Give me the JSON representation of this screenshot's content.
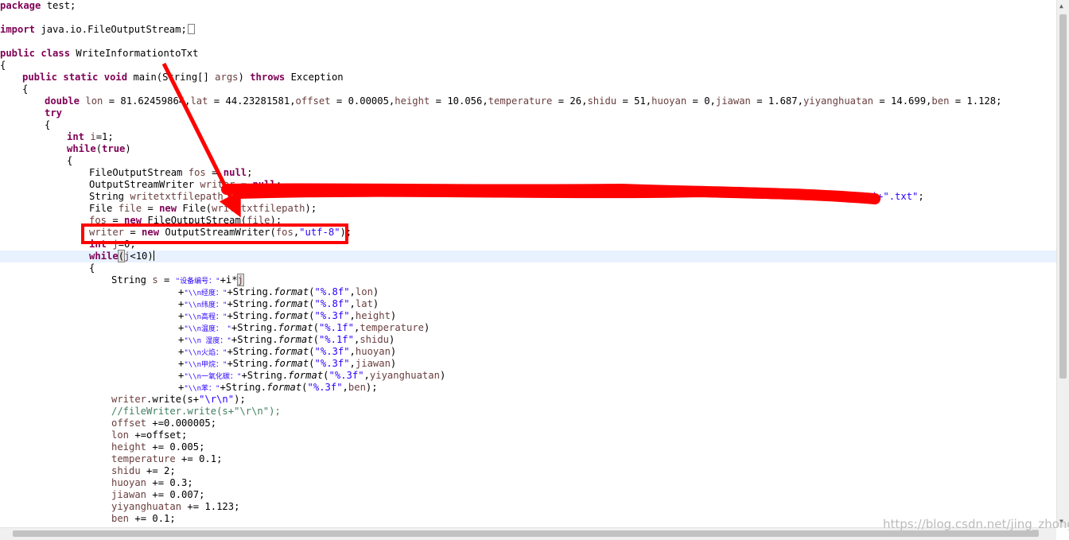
{
  "code": {
    "package_kw": "package",
    "package_name": " test;",
    "import_kw": "import",
    "import_name": " java.io.FileOutputStream;",
    "public_kw": "public",
    "class_kw": "class",
    "class_name": " WriteInformationtoTxt",
    "open_brace": "{",
    "static_kw": "static",
    "void_kw": "void",
    "main_sig_a": " main(String[] ",
    "args": "args",
    "main_sig_b": ") ",
    "throws_kw": "throws",
    "exception": " Exception",
    "double_kw": "double",
    "v_lon": "lon",
    "lon_init": " = 81.62459864,",
    "v_lat": "lat",
    "lat_init": " = 44.23281581,",
    "v_offset": "offset",
    "offset_init": " = 0.00005,",
    "v_height": "height",
    "height_init": " = 10.056,",
    "v_temperature": "temperature",
    "temperature_init": " = 26,",
    "v_shidu": "shidu",
    "shidu_init": " = 51,",
    "v_huoyan": "huoyan",
    "huoyan_init": " = 0,",
    "v_jiawan": "jiawan",
    "jiawan_init": " = 1.687,",
    "v_yiyanghuatan": "yiyanghuatan",
    "yiyanghuatan_init": " = 14.699,",
    "v_ben": "ben",
    "ben_init": " = 1.128;",
    "try_kw": "try",
    "int_kw": "int",
    "v_i": "i",
    "i_init": "=1;",
    "while_kw": "while",
    "paren_open": "(",
    "true_kw": "true",
    "paren_close": ")",
    "fos_type": "FileOutputStream ",
    "v_fos": "fos",
    "eq": " = ",
    "null_kw": "null",
    "semi": ";",
    "writer_type": "OutputStreamWriter ",
    "v_writer": "writer",
    "string_type": "String ",
    "v_writetxtfilepath": "writetxtfilepath",
    "path_tail_str": "result\"+i+\".txt\"",
    "file_type": "File ",
    "v_file": "file",
    "new_kw": "new",
    "file_ctor_a": " File(",
    "file_ctor_b": ");",
    "fos_ctor": " FileOutputStream(",
    "osw_ctor": " OutputStreamWriter(",
    "comma": ",",
    "utf8": "\"utf-8\"",
    "close_paren_semi": ");",
    "v_j": "j",
    "j_init": "=0;",
    "j_cond": "<10)",
    "s_decl": "String ",
    "v_s": "s",
    "s_eq": " = ",
    "s_str1": "\"设备编号：\"",
    "s_plus_i": "+i*",
    "fmt_lines": [
      {
        "pre": "+",
        "str": "\"\\\\n经度：\"",
        "mid": "+String.",
        "fmt": "format",
        "arg": "\"%.8f\"",
        "var": "lon",
        "end": ")"
      },
      {
        "pre": "+",
        "str": "\"\\\\n纬度：\"",
        "mid": "+String.",
        "fmt": "format",
        "arg": "\"%.8f\"",
        "var": "lat",
        "end": ")"
      },
      {
        "pre": "+",
        "str": "\"\\\\n高程：\"",
        "mid": "+String.",
        "fmt": "format",
        "arg": "\"%.3f\"",
        "var": "height",
        "end": ")"
      },
      {
        "pre": "+",
        "str": "\"\\\\n温度： \"",
        "mid": "+String.",
        "fmt": "format",
        "arg": "\"%.1f\"",
        "var": "temperature",
        "end": ")"
      },
      {
        "pre": "+",
        "str": "\"\\\\n 湿度：\"",
        "mid": "+String.",
        "fmt": "format",
        "arg": "\"%.1f\"",
        "var": "shidu",
        "end": ")"
      },
      {
        "pre": "+",
        "str": "\"\\\\n火焰：\"",
        "mid": "+String.",
        "fmt": "format",
        "arg": "\"%.3f\"",
        "var": "huoyan",
        "end": ")"
      },
      {
        "pre": "+",
        "str": "\"\\\\n甲烷：\"",
        "mid": "+String.",
        "fmt": "format",
        "arg": "\"%.3f\"",
        "var": "jiawan",
        "end": ")"
      },
      {
        "pre": "+",
        "str": "\"\\\\n一氧化碳：\"",
        "mid": "+String.",
        "fmt": "format",
        "arg": "\"%.3f\"",
        "var": "yiyanghuatan",
        "end": ")"
      },
      {
        "pre": "+",
        "str": "\"\\\\n苯：\"",
        "mid": "+String.",
        "fmt": "format",
        "arg": "\"%.3f\"",
        "var": "ben",
        "end": ");"
      }
    ],
    "write_call_a": ".write(s+",
    "write_str": "\"\\r\\n\"",
    "write_call_b": ");",
    "comment_line": "//fileWriter.write(s+\"\\r\\n\");",
    "incs": [
      {
        "var": "offset",
        "op": " +=0.000005;"
      },
      {
        "var": "lon",
        "op": " +=offset;"
      },
      {
        "var": "height",
        "op": " += 0.005;"
      },
      {
        "var": "temperature",
        "op": " += 0.1;"
      },
      {
        "var": "shidu",
        "op": " += 2;"
      },
      {
        "var": "huoyan",
        "op": " += 0.3;"
      },
      {
        "var": "jiawan",
        "op": " += 0.007;"
      },
      {
        "var": "yiyanghuatan",
        "op": " += 1.123;"
      },
      {
        "var": "ben",
        "op": " += 0.1;"
      }
    ]
  },
  "watermark": "https://blog.csdn.net/jing_zhong",
  "colors": {
    "keyword": "#7f0055",
    "string": "#2a00ff",
    "variable": "#6a3e3e",
    "comment": "#3f7f5f",
    "annotation": "#ff0000",
    "current_line": "#e8f2fe"
  },
  "annotations": {
    "arrow_icon": "red-arrow",
    "box_icon": "red-highlight-box",
    "redaction_icon": "red-scribble"
  }
}
